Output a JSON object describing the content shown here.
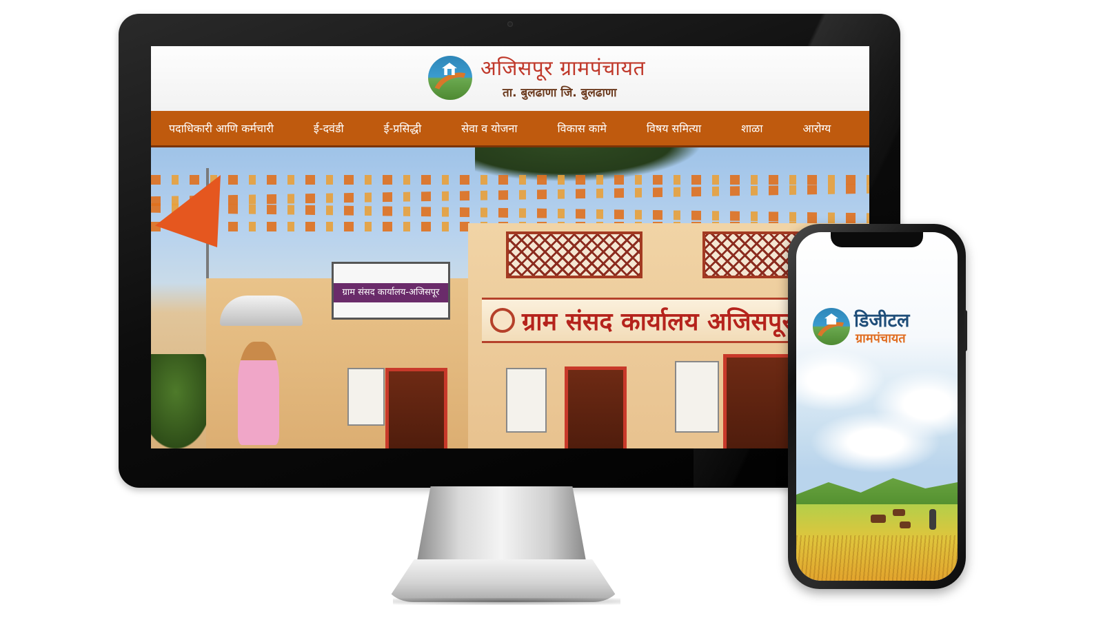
{
  "desktop_site": {
    "title": "अजिसपूर ग्रामपंचायत",
    "subtitle": "ता. बुलढाणा जि. बुलढाणा",
    "nav": [
      {
        "label": "पदाधिकारी आणि कर्मचारी"
      },
      {
        "label": "ई-दवंडी"
      },
      {
        "label": "ई-प्रसिद्धी"
      },
      {
        "label": "सेवा व योजना"
      },
      {
        "label": "विकास कामे"
      },
      {
        "label": "विषय समित्या"
      },
      {
        "label": "शाळा"
      },
      {
        "label": "आरोग्य"
      }
    ],
    "hero": {
      "signboard_text": "ग्राम संसद कार्यालय-अजिसपूर",
      "building_sign": "ग्राम संसद कार्यालय अजिसपूर"
    }
  },
  "mobile_app": {
    "title_line1": "डिजीटल",
    "title_line2": "ग्रामपंचायत"
  },
  "colors": {
    "nav_background": "#bf5a0e",
    "site_title": "#c0392b",
    "app_title_primary": "#1f4e79",
    "app_title_accent": "#e06c1f"
  },
  "icons": {
    "site_logo": "gram-panchayat-logo-icon",
    "app_logo": "gram-panchayat-logo-icon"
  }
}
